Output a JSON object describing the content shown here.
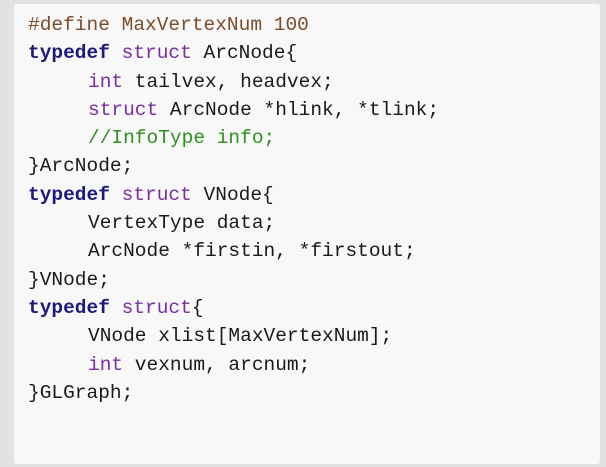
{
  "code": {
    "l1": "#define MaxVertexNum 100",
    "l2_kw": "typedef",
    "l2_ty": " struct",
    "l2_tx": " ArcNode{",
    "l3_ty": "int",
    "l3_tx": " tailvex, headvex;",
    "l4_ty": "struct",
    "l4_tx": " ArcNode *hlink, *tlink;",
    "l5_cm": "//InfoType info;",
    "l6": "}ArcNode;",
    "l7_kw": "typedef",
    "l7_ty": " struct",
    "l7_tx": " VNode{",
    "l8": "VertexType data;",
    "l9": "ArcNode *firstin, *firstout;",
    "l10": "}VNode;",
    "l11_kw": "typedef",
    "l11_ty": " struct",
    "l11_tx": "{",
    "l12": "VNode xlist[MaxVertexNum];",
    "l13_ty": "int",
    "l13_tx": " vexnum, arcnum;",
    "l14": "}GLGraph;"
  }
}
